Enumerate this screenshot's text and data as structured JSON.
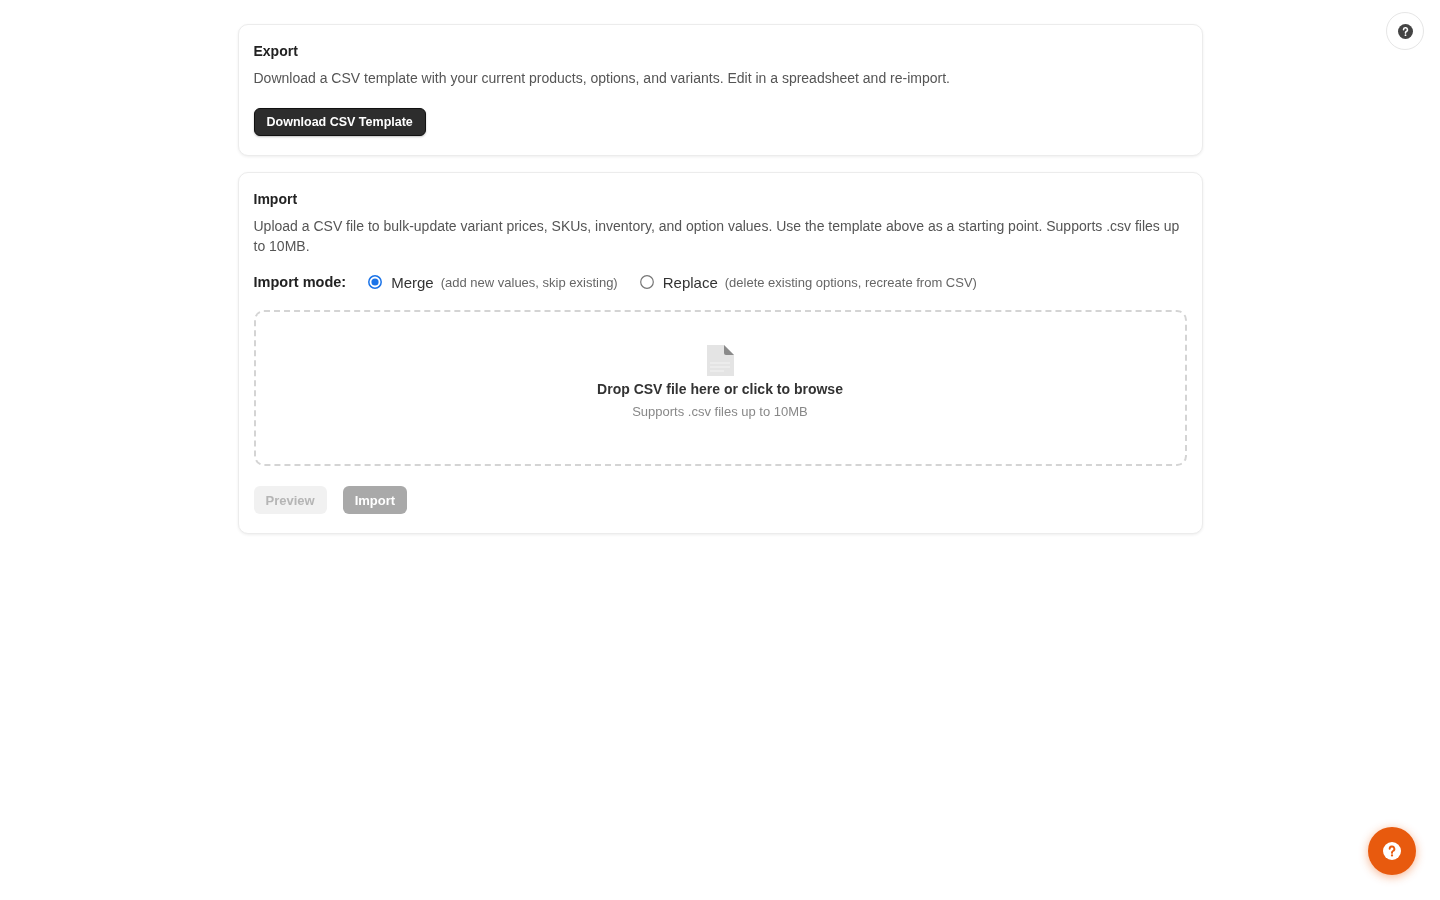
{
  "export": {
    "title": "Export",
    "description": "Download a CSV template with your current products, options, and variants. Edit in a spreadsheet and re-import.",
    "button": "Download CSV Template"
  },
  "import": {
    "title": "Import",
    "description": "Upload a CSV file to bulk-update variant prices, SKUs, inventory, and option values. Use the template above as a starting point. Supports .csv files up to 10MB.",
    "mode_label": "Import mode:",
    "modes": [
      {
        "label": "Merge",
        "hint": "(add new values, skip existing)",
        "selected": true
      },
      {
        "label": "Replace",
        "hint": "(delete existing options, recreate from CSV)",
        "selected": false
      }
    ],
    "dropzone": {
      "title": "Drop CSV file here or click to browse",
      "hint": "Supports .csv files up to 10MB"
    },
    "buttons": [
      {
        "label": "Preview",
        "kind": "secondary",
        "disabled": true
      },
      {
        "label": "Import",
        "kind": "primary",
        "disabled": true
      }
    ]
  }
}
